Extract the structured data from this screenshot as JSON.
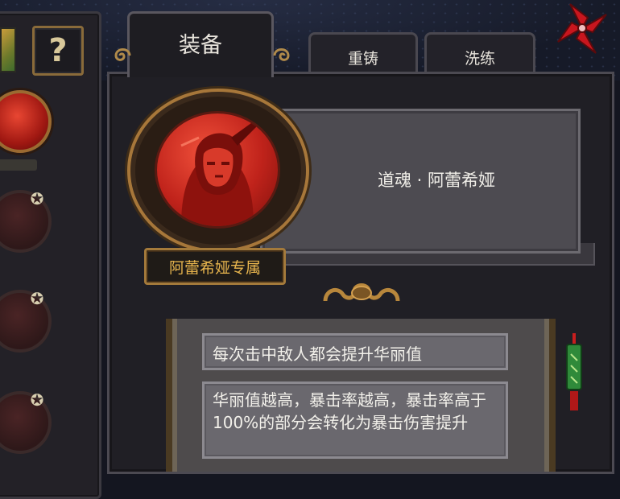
{
  "tabs": {
    "equip": "装备",
    "reforge": "重铸",
    "refine": "洗练"
  },
  "sidebar": {
    "help_label": "?",
    "star_glyph": "✪"
  },
  "item": {
    "name": "道魂 · 阿蕾希娅",
    "exclusive_label": "阿蕾希娅专属"
  },
  "effects": [
    "每次击中敌人都会提升华丽值",
    "华丽值越高，暴击率越高，暴击率高于100%的部分会转化为暴击伤害提升"
  ],
  "colors": {
    "gold_border": "#a7773a",
    "exclusive_text": "#e9b64e",
    "soul_red": "#c0231b"
  }
}
